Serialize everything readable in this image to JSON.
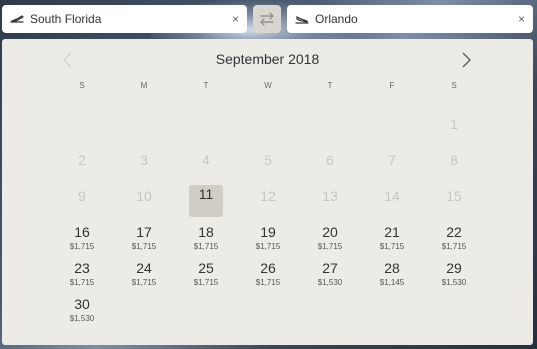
{
  "search": {
    "origin": {
      "value": "South Florida",
      "icon": "departing-plane-icon"
    },
    "destination": {
      "value": "Orlando",
      "icon": "landing-plane-icon"
    },
    "clear_glyph": "×"
  },
  "calendar": {
    "month_label": "September 2018",
    "weekdays": [
      "S",
      "M",
      "T",
      "W",
      "T",
      "F",
      "S"
    ],
    "selected_day": "11",
    "days": [
      {
        "day": "1",
        "enabled": false
      },
      {
        "day": "2",
        "enabled": false
      },
      {
        "day": "3",
        "enabled": false
      },
      {
        "day": "4",
        "enabled": false
      },
      {
        "day": "5",
        "enabled": false
      },
      {
        "day": "6",
        "enabled": false
      },
      {
        "day": "7",
        "enabled": false
      },
      {
        "day": "8",
        "enabled": false
      },
      {
        "day": "9",
        "enabled": false
      },
      {
        "day": "10",
        "enabled": false
      },
      {
        "day": "11",
        "enabled": false,
        "selected": true
      },
      {
        "day": "12",
        "enabled": false
      },
      {
        "day": "13",
        "enabled": false
      },
      {
        "day": "14",
        "enabled": false
      },
      {
        "day": "15",
        "enabled": false
      },
      {
        "day": "16",
        "enabled": true,
        "price": "$1,715"
      },
      {
        "day": "17",
        "enabled": true,
        "price": "$1,715"
      },
      {
        "day": "18",
        "enabled": true,
        "price": "$1,715"
      },
      {
        "day": "19",
        "enabled": true,
        "price": "$1,715"
      },
      {
        "day": "20",
        "enabled": true,
        "price": "$1,715"
      },
      {
        "day": "21",
        "enabled": true,
        "price": "$1,715"
      },
      {
        "day": "22",
        "enabled": true,
        "price": "$1,715"
      },
      {
        "day": "23",
        "enabled": true,
        "price": "$1,715"
      },
      {
        "day": "24",
        "enabled": true,
        "price": "$1,715"
      },
      {
        "day": "25",
        "enabled": true,
        "price": "$1,715"
      },
      {
        "day": "26",
        "enabled": true,
        "price": "$1,715"
      },
      {
        "day": "27",
        "enabled": true,
        "price": "$1,530"
      },
      {
        "day": "28",
        "enabled": true,
        "price": "$1,145"
      },
      {
        "day": "29",
        "enabled": true,
        "price": "$1,530"
      },
      {
        "day": "30",
        "enabled": true,
        "price": "$1,530"
      }
    ]
  },
  "colors": {
    "panel_bg": "#ecebe6",
    "selected_bg": "#d0cdc4",
    "disabled_text": "#c9c7c2"
  }
}
